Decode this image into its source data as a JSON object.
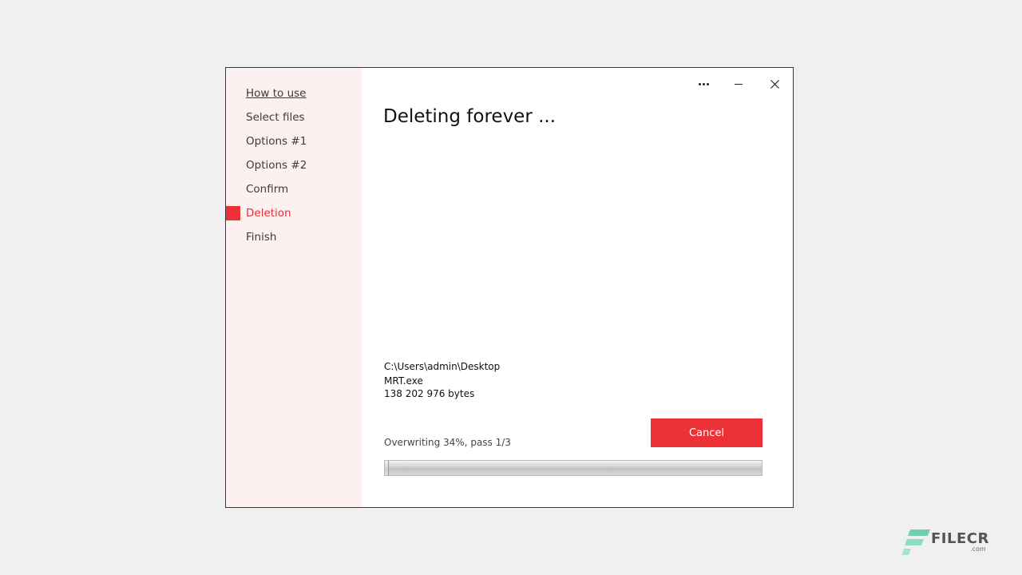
{
  "sidebar": {
    "items": [
      {
        "label": "How to use",
        "state": "link"
      },
      {
        "label": "Select files",
        "state": "normal"
      },
      {
        "label": "Options #1",
        "state": "normal"
      },
      {
        "label": "Options #2",
        "state": "normal"
      },
      {
        "label": "Confirm",
        "state": "normal"
      },
      {
        "label": "Deletion",
        "state": "active"
      },
      {
        "label": "Finish",
        "state": "normal"
      }
    ]
  },
  "window_controls": {
    "more_icon": "more-dots-icon",
    "minimize_icon": "minimize-icon",
    "close_icon": "close-icon"
  },
  "main": {
    "title": "Deleting forever ...",
    "file": {
      "path": "C:\\Users\\admin\\Desktop",
      "name": "MRT.exe",
      "size": "138 202 976 bytes"
    },
    "status": "Overwriting 34%, pass 1/3",
    "cancel_label": "Cancel",
    "progress_fraction": 0.01
  },
  "watermark": {
    "brand": "FILECR",
    "suffix": ".com"
  },
  "colors": {
    "accent": "#ec3237",
    "sidebar_bg": "#fdf0f0",
    "active_text": "#e5303a",
    "watermark_logo": "#6fd0b0"
  }
}
